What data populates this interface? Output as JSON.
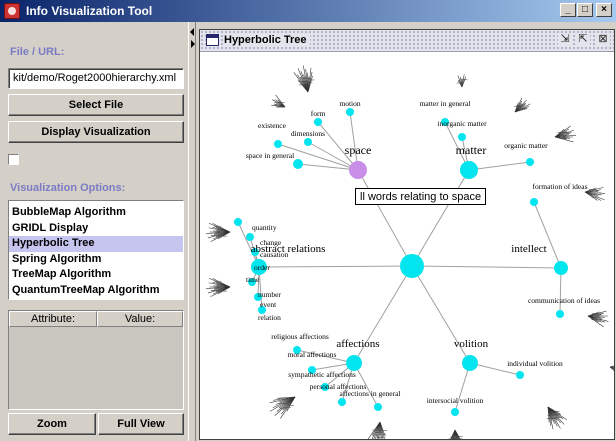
{
  "window": {
    "title": "Info Visualization Tool",
    "controls": {
      "minimize": "_",
      "maximize": "□",
      "close": "×"
    }
  },
  "left_panel": {
    "file_label": "File / URL:",
    "url_value": "kit/demo/Roget2000hierarchy.xml",
    "select_file": "Select File",
    "display_visualization": "Display Visualization",
    "options_label": "Visualization Options:",
    "algorithms": [
      "BubbleMap Algorithm",
      "GRIDL Display",
      "Hyperbolic Tree",
      "Spring Algorithm",
      "TreeMap Algorithm",
      "QuantumTreeMap Algorithm"
    ],
    "selected_algorithm": "Hyperbolic Tree",
    "table_headers": {
      "attribute": "Attribute:",
      "value": "Value:"
    },
    "zoom": "Zoom",
    "full_view": "Full View"
  },
  "frame": {
    "title": "Hyperbolic Tree",
    "controls": {
      "shrink": "⇲",
      "expand": "⇱",
      "close": "⊠"
    }
  },
  "tree": {
    "colors": {
      "node": "#00e5ee",
      "highlight": "#c88ee8",
      "edge": "#a0a0a0",
      "text": "#000000"
    },
    "categories": [
      "space",
      "matter",
      "abstract relations",
      "intellect",
      "affections",
      "volition"
    ],
    "highlighted_category": "space",
    "tooltip": "ll words relating to space",
    "sublabels": [
      "motion",
      "form",
      "dimensions",
      "existence",
      "space in general",
      "matter in general",
      "inorganic matter",
      "organic matter",
      "relation",
      "quantity",
      "time",
      "order",
      "change",
      "causation",
      "number",
      "event",
      "formation of ideas",
      "communication of ideas",
      "religious affections",
      "moral affections",
      "sympathetic affections",
      "personal affections",
      "affections in general",
      "individual volition",
      "intersocial volition"
    ]
  }
}
